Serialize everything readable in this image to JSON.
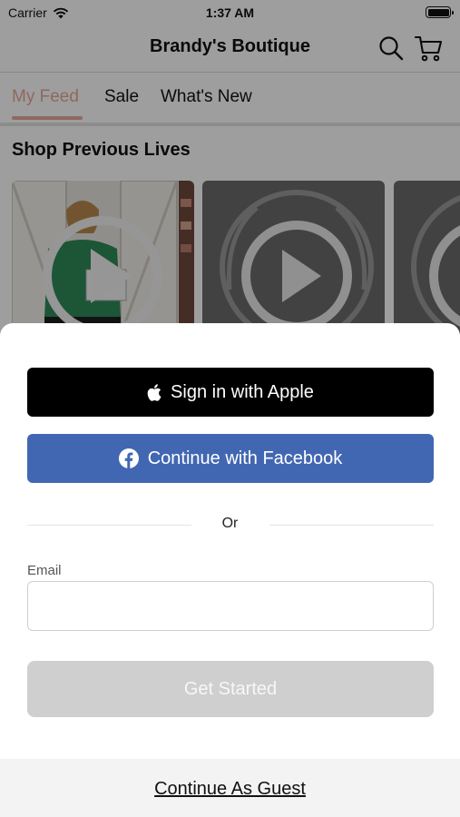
{
  "status_bar": {
    "carrier": "Carrier",
    "time": "1:37 AM",
    "icons": [
      "wifi-icon",
      "battery-icon"
    ]
  },
  "header": {
    "title": "Brandy's Boutique",
    "icons": [
      "search-icon",
      "cart-icon"
    ]
  },
  "tabs": [
    {
      "label": "My Feed",
      "active": true
    },
    {
      "label": "Sale",
      "active": false
    },
    {
      "label": "What's New",
      "active": false
    }
  ],
  "feed": {
    "section_title": "Shop Previous Lives",
    "videos": [
      {
        "icon": "play-icon"
      },
      {
        "icon": "play-icon"
      },
      {
        "icon": "play-icon"
      }
    ]
  },
  "signin_sheet": {
    "apple_button": "Sign in with Apple",
    "facebook_button": "Continue with Facebook",
    "divider_text": "Or",
    "email_label": "Email",
    "email_value": "",
    "email_placeholder": "",
    "submit_button": "Get Started",
    "guest_link": "Continue As Guest"
  },
  "colors": {
    "accent_tab": "#e8a89a",
    "facebook_blue": "#4267b2",
    "apple_black": "#000000",
    "disabled_button": "#cfcfcf"
  }
}
